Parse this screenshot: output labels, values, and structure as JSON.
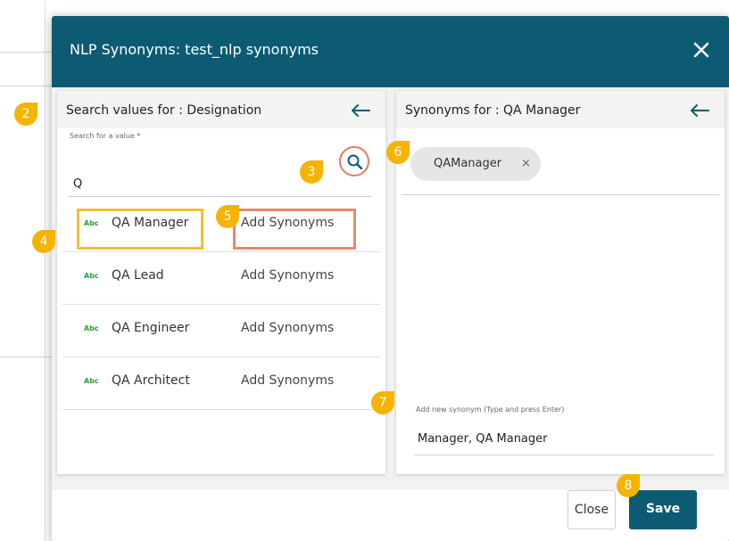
{
  "dialog": {
    "title": "NLP Synonyms: test_nlp synonyms"
  },
  "left_panel": {
    "title": "Search values for : Designation",
    "search": {
      "label": "Search for a value *",
      "value": "Q"
    },
    "rows": [
      {
        "type_badge": "Abc",
        "label": "QA Manager",
        "action": "Add Synonyms"
      },
      {
        "type_badge": "Abc",
        "label": "QA Lead",
        "action": "Add Synonyms"
      },
      {
        "type_badge": "Abc",
        "label": "QA Engineer",
        "action": "Add Synonyms"
      },
      {
        "type_badge": "Abc",
        "label": "QA Architect",
        "action": "Add Synonyms"
      }
    ]
  },
  "right_panel": {
    "title": "Synonyms for : QA Manager",
    "chips": [
      {
        "label": "QAManager",
        "remove": "×"
      }
    ],
    "new_synonym": {
      "label": "Add new synonym (Type and press Enter)",
      "value": "Manager, QA Manager"
    }
  },
  "footer": {
    "close_label": "Close",
    "save_label": "Save"
  },
  "annotations": {
    "markers": [
      "2",
      "3",
      "4",
      "5",
      "6",
      "7",
      "8"
    ],
    "marker_color": "#f4b400",
    "yellow_highlight": "#f0c030",
    "orange_highlight": "#e68a6a"
  },
  "colors": {
    "header": "#0d5b73",
    "save_button": "#0d5b73",
    "abc_badge": "#2f9d3a"
  }
}
